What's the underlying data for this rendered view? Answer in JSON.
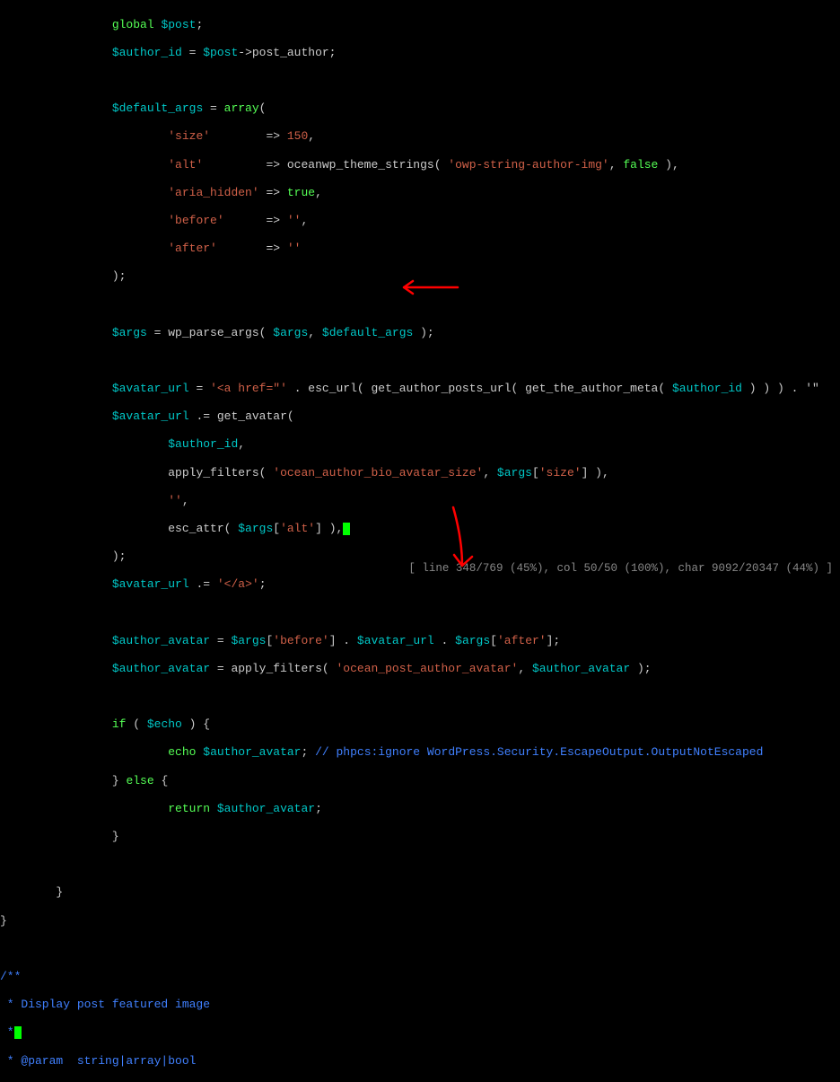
{
  "code": {
    "l1_kw": "global",
    "l1_var": " $post",
    "l1_end": ";",
    "l2_var1": "$author_id",
    "l2_eq": " = ",
    "l2_var2": "$post",
    "l2_arrow": "->post_author;",
    "l3_var": "$default_args",
    "l3_eq": " = ",
    "l3_kw": "array",
    "l3_paren": "(",
    "l4_str": "'size'",
    "l4_arrow": "        => ",
    "l4_val": "150",
    "l4_end": ",",
    "l5_str": "'alt'",
    "l5_arrow": "         => oceanwp_theme_strings( ",
    "l5_str2": "'owp-string-author-img'",
    "l5_mid": ", ",
    "l5_kw": "false",
    "l5_end": " ),",
    "l6_str": "'aria_hidden'",
    "l6_arrow": " => ",
    "l6_kw": "true",
    "l6_end": ",",
    "l7_str": "'before'",
    "l7_arrow": "      => ",
    "l7_val": "''",
    "l7_end": ",",
    "l8_str": "'after'",
    "l8_arrow": "       => ",
    "l8_val": "''",
    "l9_close": ");",
    "l10_var": "$args",
    "l10_mid": " = wp_parse_args( ",
    "l10_var2": "$args",
    "l10_mid2": ", ",
    "l10_var3": "$default_args",
    "l10_end": " );",
    "l11_var": "$avatar_url",
    "l11_eq": " = ",
    "l11_str": "'<a href=\"'",
    "l11_mid": " . esc_url( get_author_posts_url( get_the_author_meta( ",
    "l11_var2": "$author_id",
    "l11_end": " ) ) ) . '\"",
    "l12_var": "$avatar_url",
    "l12_mid": " .= get_avatar(",
    "l13_var": "$author_id",
    "l13_end": ",",
    "l14_mid": "apply_filters( ",
    "l14_str": "'ocean_author_bio_avatar_size'",
    "l14_mid2": ", ",
    "l14_var": "$args",
    "l14_idx": "[",
    "l14_str2": "'size'",
    "l14_end": "] ),",
    "l15_str": "''",
    "l15_end": ",",
    "l16_mid": "esc_attr( ",
    "l16_var": "$args",
    "l16_idx": "[",
    "l16_str": "'alt'",
    "l16_end": "] ),",
    "l17_close": ");",
    "l18_var": "$avatar_url",
    "l18_mid": " .= ",
    "l18_str": "'</a>'",
    "l18_end": ";",
    "l19_var": "$author_avatar",
    "l19_eq": " = ",
    "l19_var2": "$args",
    "l19_idx": "[",
    "l19_str": "'before'",
    "l19_mid": "] . ",
    "l19_var3": "$avatar_url",
    "l19_mid2": " . ",
    "l19_var4": "$args",
    "l19_idx2": "[",
    "l19_str2": "'after'",
    "l19_end": "];",
    "l20_var": "$author_avatar",
    "l20_mid": " = apply_filters( ",
    "l20_str": "'ocean_post_author_avatar'",
    "l20_mid2": ", ",
    "l20_var2": "$author_avatar",
    "l20_end": " );",
    "l21_kw": "if",
    "l21_mid": " ( ",
    "l21_var": "$echo",
    "l21_end": " ) {",
    "l22_kw": "echo",
    "l22_sp": " ",
    "l22_var": "$author_avatar",
    "l22_mid": "; ",
    "l22_comment": "// phpcs:ignore WordPress.Security.EscapeOutput.OutputNotEscaped",
    "l23_mid": "} ",
    "l23_kw": "else",
    "l23_end": " {",
    "l24_kw": "return",
    "l24_sp": " ",
    "l24_var": "$author_avatar",
    "l24_end": ";",
    "l25_close": "}",
    "l26_close": "}",
    "l27_close": "}",
    "doc1": "/**",
    "doc2": " * Display post featured image",
    "doc3": " *",
    "doc4": " * @param  string|array|bool"
  },
  "status": "[ line 348/769 (45%), col 50/50 (100%), char 9092/20347 (44%) ]"
}
